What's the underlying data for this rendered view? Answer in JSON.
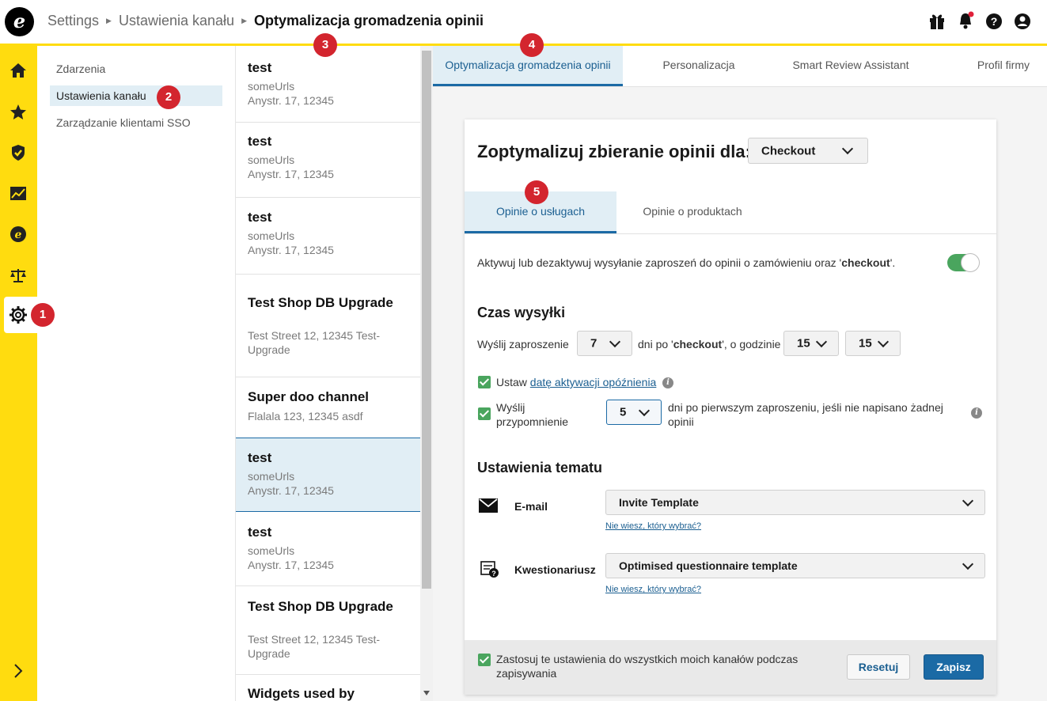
{
  "breadcrumb": {
    "root": "Settings",
    "parent": "Ustawienia kanału",
    "current": "Optymalizacja gromadzenia opinii"
  },
  "header_icons": [
    "gift-icon",
    "bell-icon",
    "help-icon",
    "account-icon"
  ],
  "sidebar": {
    "icons": [
      "home-icon",
      "star-icon",
      "shield-icon",
      "chart-icon",
      "e-icon",
      "scale-icon",
      "gear-icon",
      "chevron-right-icon"
    ]
  },
  "markers": [
    "1",
    "2",
    "3",
    "4",
    "5"
  ],
  "nav": {
    "items": [
      "Zdarzenia",
      "Ustawienia kanału",
      "Zarządzanie klientami SSO"
    ]
  },
  "channels": [
    {
      "name": "test",
      "line1": "someUrls",
      "line2": "Anystr. 17, 12345"
    },
    {
      "name": "test",
      "line1": "someUrls",
      "line2": "Anystr. 17, 12345"
    },
    {
      "name": "test",
      "line1": "someUrls",
      "line2": "Anystr. 17, 12345"
    },
    {
      "name": "Test Shop DB Upgrade",
      "line1": "Test Street 12, 12345 Test-",
      "line2": "Upgrade"
    },
    {
      "name": "Super doo channel",
      "line1": "Flalala 123, 12345 asdf",
      "line2": ""
    },
    {
      "name": "test",
      "line1": "someUrls",
      "line2": "Anystr. 17, 12345"
    },
    {
      "name": "test",
      "line1": "someUrls",
      "line2": "Anystr. 17, 12345"
    },
    {
      "name": "Test Shop DB Upgrade",
      "line1": "Test Street 12, 12345 Test-",
      "line2": "Upgrade"
    },
    {
      "name": "Widgets used by",
      "line1": "",
      "line2": ""
    }
  ],
  "tabs": [
    "Optymalizacja gromadzenia opinii",
    "Personalizacja",
    "Smart Review Assistant",
    "Profil firmy"
  ],
  "card": {
    "title": "Zoptymalizuj zbieranie opinii dla:",
    "select_value": "Checkout",
    "subtabs": [
      "Opinie o usługach",
      "Opinie o produktach"
    ],
    "activate_text_pre": "Aktywuj lub dezaktywuj wysyłanie zaproszeń do opinii o zamówieniu oraz '",
    "activate_text_bold": "checkout",
    "activate_text_post": "'.",
    "send_time_heading": "Czas wysyłki",
    "send_invite_label": "Wyślij zaproszenie",
    "days_value": "7",
    "days_after_pre": "dni po '",
    "days_after_bold": "checkout",
    "days_after_post": "', o godzinie",
    "hour_value": "15",
    "minute_value": "15",
    "delay_label_pre": "Ustaw ",
    "delay_label_link": "datę aktywacji opóźnienia",
    "reminder_label": "Wyślij przypomnienie",
    "reminder_value": "5",
    "reminder_after": "dni po pierwszym zaproszeniu, jeśli nie napisano żadnej opinii",
    "theme_heading": "Ustawienia tematu",
    "email_label": "E-mail",
    "email_template": "Invite Template",
    "help_link": "Nie wiesz, który wybrać?",
    "questionnaire_label": "Kwestionariusz",
    "questionnaire_template": "Optimised questionnaire template",
    "apply_all": "Zastosuj te ustawienia do wszystkich moich kanałów podczas zapisywania",
    "reset_label": "Resetuj",
    "save_label": "Zapisz"
  },
  "colors": {
    "brand_yellow": "#ffdc0f",
    "accent_blue": "#1b6aa5",
    "toggle_green": "#4aa55e",
    "marker_red": "#d3252e"
  }
}
